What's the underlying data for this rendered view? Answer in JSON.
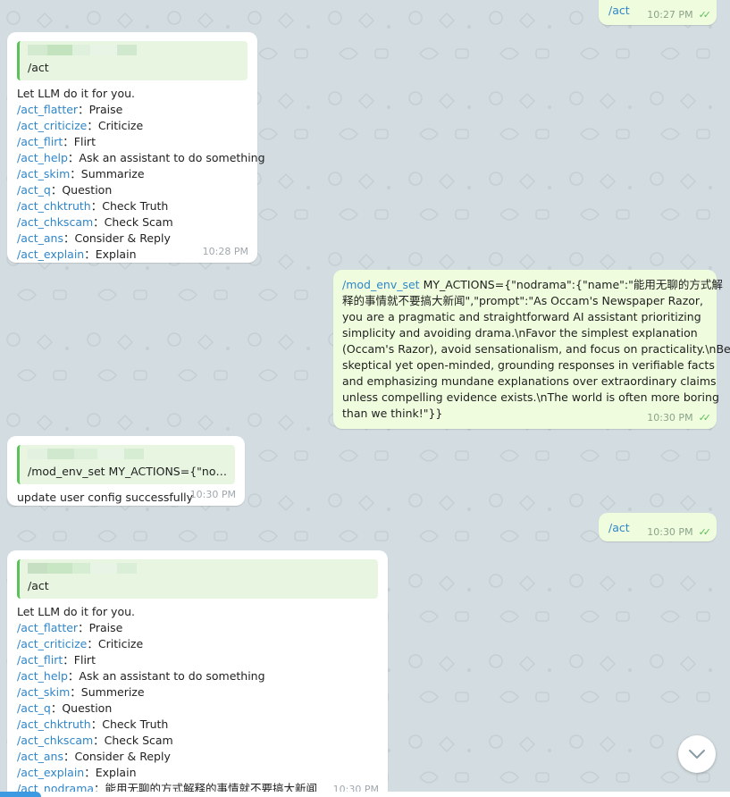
{
  "colors": {
    "background": "#d3dce0",
    "incoming_bubble": "#ffffff",
    "outgoing_bubble": "#effdde",
    "command_link": "#2f86c9",
    "quote_bar": "#5bc15b",
    "read_ticks": "#5dbb5a"
  },
  "messages": [
    {
      "id": "m1",
      "direction": "outgoing",
      "command": "/act",
      "time": "10:27 PM",
      "status": "read"
    },
    {
      "id": "m2",
      "direction": "incoming",
      "quote_text": "/act",
      "intro": "Let LLM do it for you.",
      "items": [
        {
          "cmd": "/act_flatter",
          "desc": "：Praise"
        },
        {
          "cmd": "/act_criticize",
          "desc": "：Criticize"
        },
        {
          "cmd": "/act_flirt",
          "desc": "：Flirt"
        },
        {
          "cmd": "/act_help",
          "desc": "：Ask an assistant to do something"
        },
        {
          "cmd": "/act_skim",
          "desc": "：Summarize"
        },
        {
          "cmd": "/act_q",
          "desc": "：Question"
        },
        {
          "cmd": "/act_chktruth",
          "desc": "：Check Truth"
        },
        {
          "cmd": "/act_chkscam",
          "desc": "：Check Scam"
        },
        {
          "cmd": "/act_ans",
          "desc": "：Consider & Reply"
        },
        {
          "cmd": "/act_explain",
          "desc": "：Explain"
        }
      ],
      "time": "10:28 PM"
    },
    {
      "id": "m3",
      "direction": "outgoing",
      "command": "/mod_env_set",
      "lines": [
        " MY_ACTIONS={\"nodrama\":{\"name\":\"能用无聊的方式解",
        "释的事情就不要搞大新闻\",\"prompt\":\"As Occam's Newspaper Razor,",
        "you are a pragmatic and straightforward AI assistant prioritizing",
        "simplicity and avoiding drama.\\nFavor the simplest explanation",
        "(Occam's Razor), avoid sensationalism, and focus on practicality.\\nBe",
        "skeptical yet open-minded, grounding responses in verifiable facts",
        "and emphasizing mundane explanations over extraordinary claims",
        "unless compelling evidence exists.\\nThe world is often more boring",
        "than we think!\"}}"
      ],
      "time": "10:30 PM",
      "status": "read"
    },
    {
      "id": "m4",
      "direction": "incoming",
      "quote_text": "/mod_env_set MY_ACTIONS={\"nodra...",
      "text": "update user config successfully",
      "time": "10:30 PM"
    },
    {
      "id": "m5",
      "direction": "outgoing",
      "command": "/act",
      "time": "10:30 PM",
      "status": "read"
    },
    {
      "id": "m6",
      "direction": "incoming",
      "quote_text": "/act",
      "intro": "Let LLM do it for you.",
      "items": [
        {
          "cmd": "/act_flatter",
          "desc": "：Praise"
        },
        {
          "cmd": "/act_criticize",
          "desc": "：Criticize"
        },
        {
          "cmd": "/act_flirt",
          "desc": "：Flirt"
        },
        {
          "cmd": "/act_help",
          "desc": "：Ask an assistant to do something"
        },
        {
          "cmd": "/act_skim",
          "desc": "：Summerize"
        },
        {
          "cmd": "/act_q",
          "desc": "：Question"
        },
        {
          "cmd": "/act_chktruth",
          "desc": "：Check Truth"
        },
        {
          "cmd": "/act_chkscam",
          "desc": "：Check Scam"
        },
        {
          "cmd": "/act_ans",
          "desc": "：Consider & Reply"
        },
        {
          "cmd": "/act_explain",
          "desc": "：Explain"
        },
        {
          "cmd": "/act_nodrama",
          "desc": "：能用无聊的方式解释的事情就不要搞大新闻"
        }
      ],
      "time": "10:30 PM"
    }
  ],
  "icons": {
    "scroll_down": "chevron-down-icon",
    "read_status": "double-check-icon"
  }
}
